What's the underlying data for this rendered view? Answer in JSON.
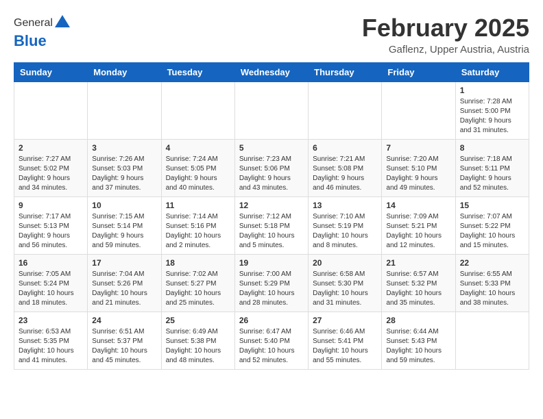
{
  "logo": {
    "general": "General",
    "blue": "Blue"
  },
  "header": {
    "month_year": "February 2025",
    "location": "Gaflenz, Upper Austria, Austria"
  },
  "weekdays": [
    "Sunday",
    "Monday",
    "Tuesday",
    "Wednesday",
    "Thursday",
    "Friday",
    "Saturday"
  ],
  "weeks": [
    [
      {
        "day": "",
        "info": ""
      },
      {
        "day": "",
        "info": ""
      },
      {
        "day": "",
        "info": ""
      },
      {
        "day": "",
        "info": ""
      },
      {
        "day": "",
        "info": ""
      },
      {
        "day": "",
        "info": ""
      },
      {
        "day": "1",
        "info": "Sunrise: 7:28 AM\nSunset: 5:00 PM\nDaylight: 9 hours and 31 minutes."
      }
    ],
    [
      {
        "day": "2",
        "info": "Sunrise: 7:27 AM\nSunset: 5:02 PM\nDaylight: 9 hours and 34 minutes."
      },
      {
        "day": "3",
        "info": "Sunrise: 7:26 AM\nSunset: 5:03 PM\nDaylight: 9 hours and 37 minutes."
      },
      {
        "day": "4",
        "info": "Sunrise: 7:24 AM\nSunset: 5:05 PM\nDaylight: 9 hours and 40 minutes."
      },
      {
        "day": "5",
        "info": "Sunrise: 7:23 AM\nSunset: 5:06 PM\nDaylight: 9 hours and 43 minutes."
      },
      {
        "day": "6",
        "info": "Sunrise: 7:21 AM\nSunset: 5:08 PM\nDaylight: 9 hours and 46 minutes."
      },
      {
        "day": "7",
        "info": "Sunrise: 7:20 AM\nSunset: 5:10 PM\nDaylight: 9 hours and 49 minutes."
      },
      {
        "day": "8",
        "info": "Sunrise: 7:18 AM\nSunset: 5:11 PM\nDaylight: 9 hours and 52 minutes."
      }
    ],
    [
      {
        "day": "9",
        "info": "Sunrise: 7:17 AM\nSunset: 5:13 PM\nDaylight: 9 hours and 56 minutes."
      },
      {
        "day": "10",
        "info": "Sunrise: 7:15 AM\nSunset: 5:14 PM\nDaylight: 9 hours and 59 minutes."
      },
      {
        "day": "11",
        "info": "Sunrise: 7:14 AM\nSunset: 5:16 PM\nDaylight: 10 hours and 2 minutes."
      },
      {
        "day": "12",
        "info": "Sunrise: 7:12 AM\nSunset: 5:18 PM\nDaylight: 10 hours and 5 minutes."
      },
      {
        "day": "13",
        "info": "Sunrise: 7:10 AM\nSunset: 5:19 PM\nDaylight: 10 hours and 8 minutes."
      },
      {
        "day": "14",
        "info": "Sunrise: 7:09 AM\nSunset: 5:21 PM\nDaylight: 10 hours and 12 minutes."
      },
      {
        "day": "15",
        "info": "Sunrise: 7:07 AM\nSunset: 5:22 PM\nDaylight: 10 hours and 15 minutes."
      }
    ],
    [
      {
        "day": "16",
        "info": "Sunrise: 7:05 AM\nSunset: 5:24 PM\nDaylight: 10 hours and 18 minutes."
      },
      {
        "day": "17",
        "info": "Sunrise: 7:04 AM\nSunset: 5:26 PM\nDaylight: 10 hours and 21 minutes."
      },
      {
        "day": "18",
        "info": "Sunrise: 7:02 AM\nSunset: 5:27 PM\nDaylight: 10 hours and 25 minutes."
      },
      {
        "day": "19",
        "info": "Sunrise: 7:00 AM\nSunset: 5:29 PM\nDaylight: 10 hours and 28 minutes."
      },
      {
        "day": "20",
        "info": "Sunrise: 6:58 AM\nSunset: 5:30 PM\nDaylight: 10 hours and 31 minutes."
      },
      {
        "day": "21",
        "info": "Sunrise: 6:57 AM\nSunset: 5:32 PM\nDaylight: 10 hours and 35 minutes."
      },
      {
        "day": "22",
        "info": "Sunrise: 6:55 AM\nSunset: 5:33 PM\nDaylight: 10 hours and 38 minutes."
      }
    ],
    [
      {
        "day": "23",
        "info": "Sunrise: 6:53 AM\nSunset: 5:35 PM\nDaylight: 10 hours and 41 minutes."
      },
      {
        "day": "24",
        "info": "Sunrise: 6:51 AM\nSunset: 5:37 PM\nDaylight: 10 hours and 45 minutes."
      },
      {
        "day": "25",
        "info": "Sunrise: 6:49 AM\nSunset: 5:38 PM\nDaylight: 10 hours and 48 minutes."
      },
      {
        "day": "26",
        "info": "Sunrise: 6:47 AM\nSunset: 5:40 PM\nDaylight: 10 hours and 52 minutes."
      },
      {
        "day": "27",
        "info": "Sunrise: 6:46 AM\nSunset: 5:41 PM\nDaylight: 10 hours and 55 minutes."
      },
      {
        "day": "28",
        "info": "Sunrise: 6:44 AM\nSunset: 5:43 PM\nDaylight: 10 hours and 59 minutes."
      },
      {
        "day": "",
        "info": ""
      }
    ]
  ]
}
